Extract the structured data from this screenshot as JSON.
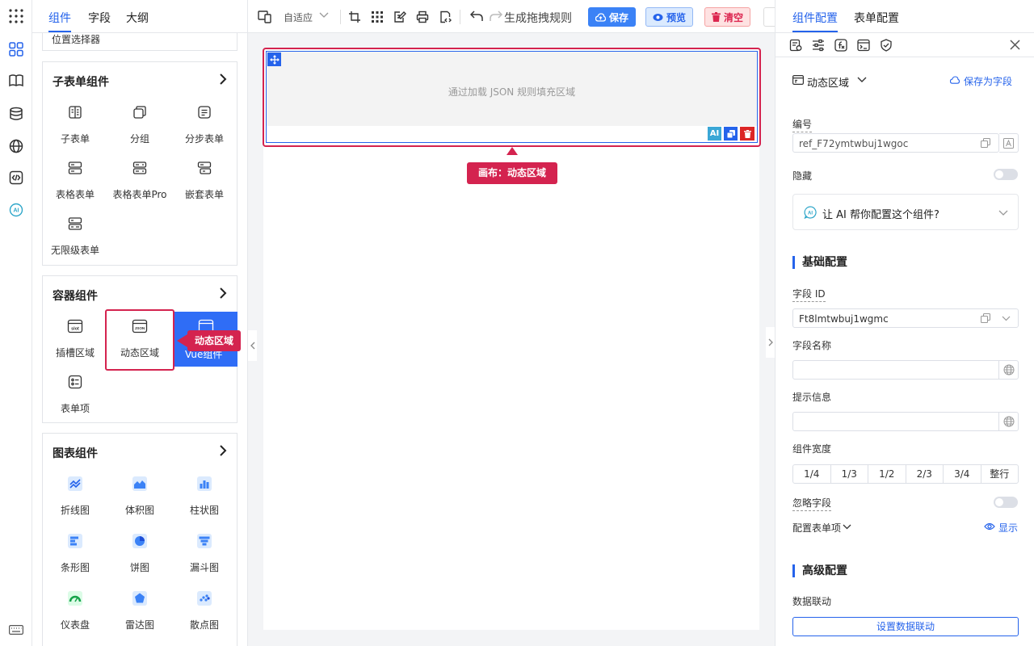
{
  "left_panel": {
    "tabs": [
      "组件",
      "字段",
      "大纲"
    ],
    "truncated_item": "位置选择器",
    "groups": [
      {
        "title": "子表单组件",
        "items": [
          "子表单",
          "分组",
          "分步表单",
          "表格表单",
          "表格表单Pro",
          "嵌套表单",
          "无限级表单"
        ]
      },
      {
        "title": "容器组件",
        "items": [
          "插槽区域",
          "动态区域",
          "Vue组件",
          "表单项"
        ]
      },
      {
        "title": "图表组件",
        "items": [
          "折线图",
          "体积图",
          "柱状图",
          "条形图",
          "饼图",
          "漏斗图",
          "仪表盘",
          "雷达图",
          "散点图"
        ]
      }
    ],
    "tooltip": "动态区域",
    "icon_texts": {
      "slot": "slot",
      "json": "JSON"
    }
  },
  "toolbar": {
    "adapt_label": "自适应",
    "generate_rules": "生成拖拽规则",
    "save": "保存",
    "preview": "预览",
    "clear": "清空"
  },
  "canvas": {
    "placeholder": "通过加载 JSON 规则填充区域",
    "badge": "画布：动态区域",
    "ai_label": "AI"
  },
  "right_panel": {
    "tabs": [
      "组件配置",
      "表单配置"
    ],
    "component_name": "动态区域",
    "save_as_field": "保存为字段",
    "id_label": "编号",
    "id_value": "ref_F72ymtwbuj1wgoc",
    "hidden_label": "隐藏",
    "ai_prompt": "让 AI 帮你配置这个组件?",
    "basic_title": "基础配置",
    "field_id_label": "字段 ID",
    "field_id_value": "Ft8lmtwbuj1wgmc",
    "field_name_label": "字段名称",
    "hint_label": "提示信息",
    "width_label": "组件宽度",
    "width_options": [
      "1/4",
      "1/3",
      "1/2",
      "2/3",
      "3/4",
      "整行"
    ],
    "ignore_label": "忽略字段",
    "form_item_label": "配置表单项",
    "show_label": "显示",
    "advanced_title": "高级配置",
    "data_link_label": "数据联动",
    "data_link_button": "设置数据联动"
  },
  "colors": {
    "primary": "#2563eb",
    "danger": "#dc2650",
    "save_bg": "#3b82f6",
    "preview_bg": "#dbeafe",
    "clear_bg": "#fee2e2"
  }
}
